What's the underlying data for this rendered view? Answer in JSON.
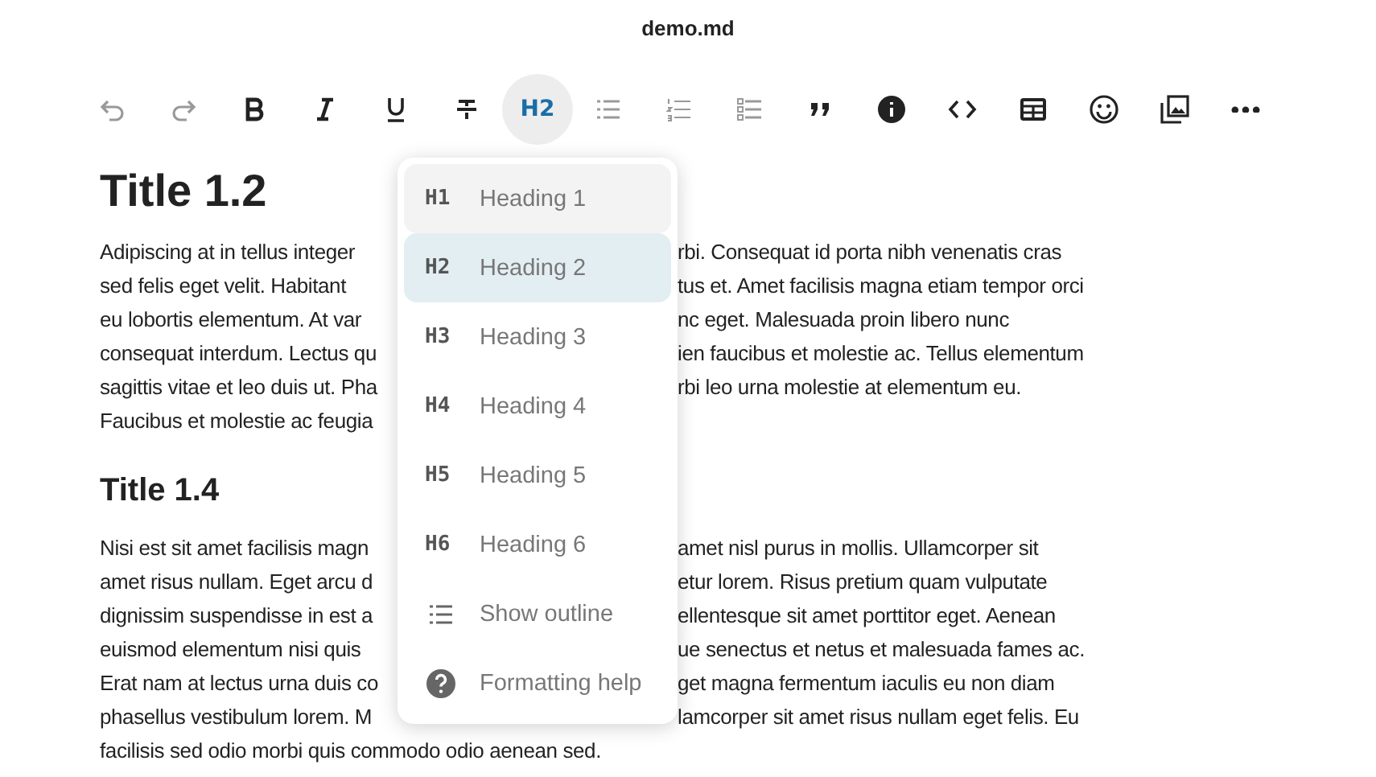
{
  "window": {
    "title": "demo.md"
  },
  "toolbar": [
    {
      "kind": "undo",
      "disabled": true
    },
    {
      "kind": "redo",
      "disabled": true
    },
    {
      "kind": "bold",
      "disabled": false
    },
    {
      "kind": "italic",
      "disabled": false
    },
    {
      "kind": "underline",
      "disabled": false
    },
    {
      "kind": "strikethrough",
      "disabled": false
    },
    {
      "kind": "heading",
      "label": "H2",
      "active": true,
      "disabled": false
    },
    {
      "kind": "bullet-list",
      "disabled": true
    },
    {
      "kind": "numbered-list",
      "disabled": true
    },
    {
      "kind": "checklist",
      "disabled": true
    },
    {
      "kind": "quote",
      "disabled": false
    },
    {
      "kind": "info",
      "disabled": false
    },
    {
      "kind": "code",
      "disabled": false
    },
    {
      "kind": "table",
      "disabled": false
    },
    {
      "kind": "emoji",
      "disabled": false
    },
    {
      "kind": "image",
      "disabled": false
    },
    {
      "kind": "more",
      "disabled": false
    }
  ],
  "document": [
    {
      "kind": "h1",
      "text": "Title 1.2"
    },
    {
      "kind": "paragraph",
      "lines": [
        {
          "left": "Adipiscing at in tellus integer",
          "right": "rbi. Consequat id porta nibh venenatis cras"
        },
        {
          "left": "sed felis eget velit. Habitant",
          "right": "tus et. Amet facilisis magna etiam tempor orci"
        },
        {
          "left": "eu lobortis elementum. At var",
          "right": "nc eget. Malesuada proin libero nunc"
        },
        {
          "left": "consequat interdum. Lectus qu",
          "right": "ien faucibus et molestie ac. Tellus elementum"
        },
        {
          "left": "sagittis vitae et leo duis ut. Pha",
          "right": "rbi leo urna molestie at elementum eu."
        },
        {
          "left": "Faucibus et molestie ac feugia"
        }
      ]
    },
    {
      "kind": "h2",
      "text": "Title 1.4"
    },
    {
      "kind": "paragraph",
      "lines": [
        {
          "left": "Nisi est sit amet facilisis magn",
          "right": "amet nisl purus in mollis. Ullamcorper sit"
        },
        {
          "left": "amet risus nullam. Eget arcu d",
          "right": "etur lorem. Risus pretium quam vulputate"
        },
        {
          "left": "dignissim suspendisse in est a",
          "right": "ellentesque sit amet porttitor eget. Aenean"
        },
        {
          "left": "euismod elementum nisi quis",
          "right": "ue senectus et netus et malesuada fames ac."
        },
        {
          "left": "Erat nam at lectus urna duis co",
          "right": "get magna fermentum iaculis eu non diam"
        },
        {
          "left": "phasellus vestibulum lorem. M",
          "right": "lamcorper sit amet risus nullam eget felis. Eu"
        },
        {
          "left": "facilisis sed odio morbi quis commodo odio aenean sed."
        }
      ]
    }
  ],
  "heading_menu": {
    "items": [
      {
        "kind": "heading",
        "badge": "H1",
        "label": "Heading 1",
        "selected": false,
        "hovered": true
      },
      {
        "kind": "heading",
        "badge": "H2",
        "label": "Heading 2",
        "selected": true,
        "hovered": false
      },
      {
        "kind": "heading",
        "badge": "H3",
        "label": "Heading 3",
        "selected": false,
        "hovered": false
      },
      {
        "kind": "heading",
        "badge": "H4",
        "label": "Heading 4",
        "selected": false,
        "hovered": false
      },
      {
        "kind": "heading",
        "badge": "H5",
        "label": "Heading 5",
        "selected": false,
        "hovered": false
      },
      {
        "kind": "heading",
        "badge": "H6",
        "label": "Heading 6",
        "selected": false,
        "hovered": false
      },
      {
        "kind": "outline",
        "label": "Show outline",
        "selected": false,
        "hovered": false
      },
      {
        "kind": "help",
        "label": "Formatting help",
        "selected": false,
        "hovered": false
      }
    ]
  }
}
